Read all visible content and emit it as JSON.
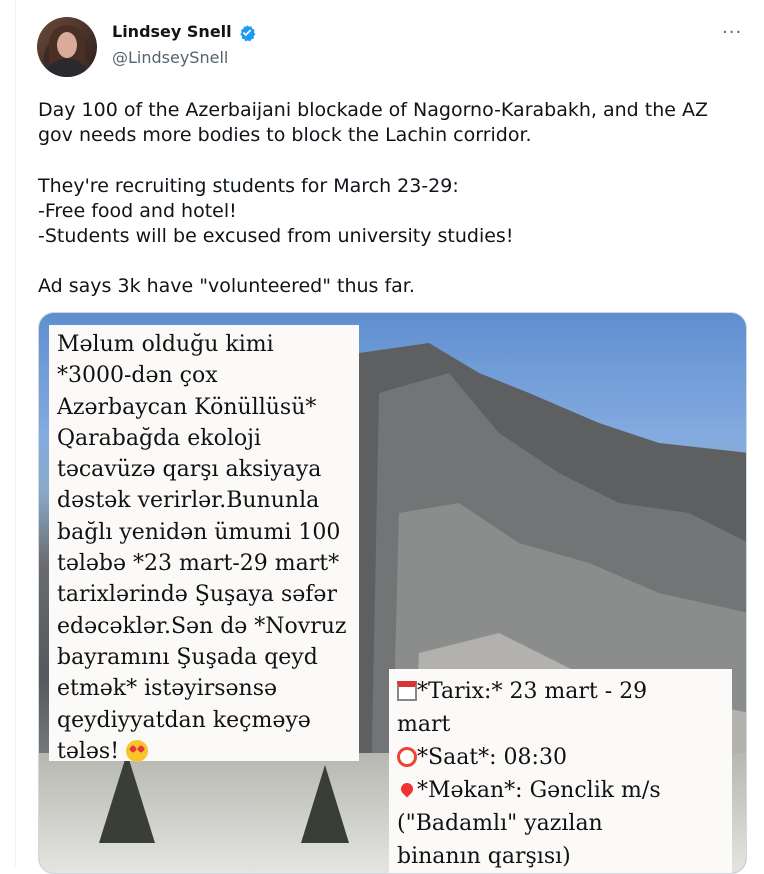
{
  "author": {
    "name": "Lindsey Snell",
    "handle": "@LindseySnell"
  },
  "menu": {
    "more_label": "···"
  },
  "tweet": {
    "paragraph1": "Day 100 of the Azerbaijani blockade of Nagorno-Karabakh, and the AZ gov needs more bodies to block the Lachin corridor.",
    "paragraph2_line1": "They're recruiting students for March 23-29:",
    "paragraph2_line2": "-Free food and hotel!",
    "paragraph2_line3": "-Students will be excused from university studies!",
    "paragraph3": "Ad says 3k have \"volunteered\" thus far."
  },
  "media": {
    "card1_lines": [
      "Məlum olduğu kimi",
      "*3000-dən çox",
      "Azərbaycan Könüllüsü*",
      "Qarabağda ekoloji",
      "təcavüzə qarşı aksiyaya",
      "dəstək verirlər.Bununla",
      "bağlı yenidən ümumi 100",
      "tələbə *23 mart-29 mart*",
      "tarixlərində Şuşaya səfər",
      "edəcəklər.Sən də *Novruz",
      "bayramını Şuşada qeyd",
      "etmək* istəyirsənsə",
      "qeydiyyatdan keçməyə"
    ],
    "card1_last": "tələs!",
    "card2_date": "*Tarix:* 23 mart - 29",
    "card2_date2": "mart",
    "card2_time": "*Saat*: 08:30",
    "card2_place": "*Məkan*: Gənclik m/s",
    "card2_place2": "(\"Badamlı\" yazılan",
    "card2_place3": "binanın qarşısı)"
  },
  "colors": {
    "verified": "#1d9bf0",
    "muted": "#536471",
    "text": "#0f1419"
  },
  "icons": [
    "verified-badge-icon",
    "more-options-icon",
    "calendar-icon",
    "alarm-clock-icon",
    "location-pin-icon",
    "heart-eyes-emoji-icon"
  ]
}
